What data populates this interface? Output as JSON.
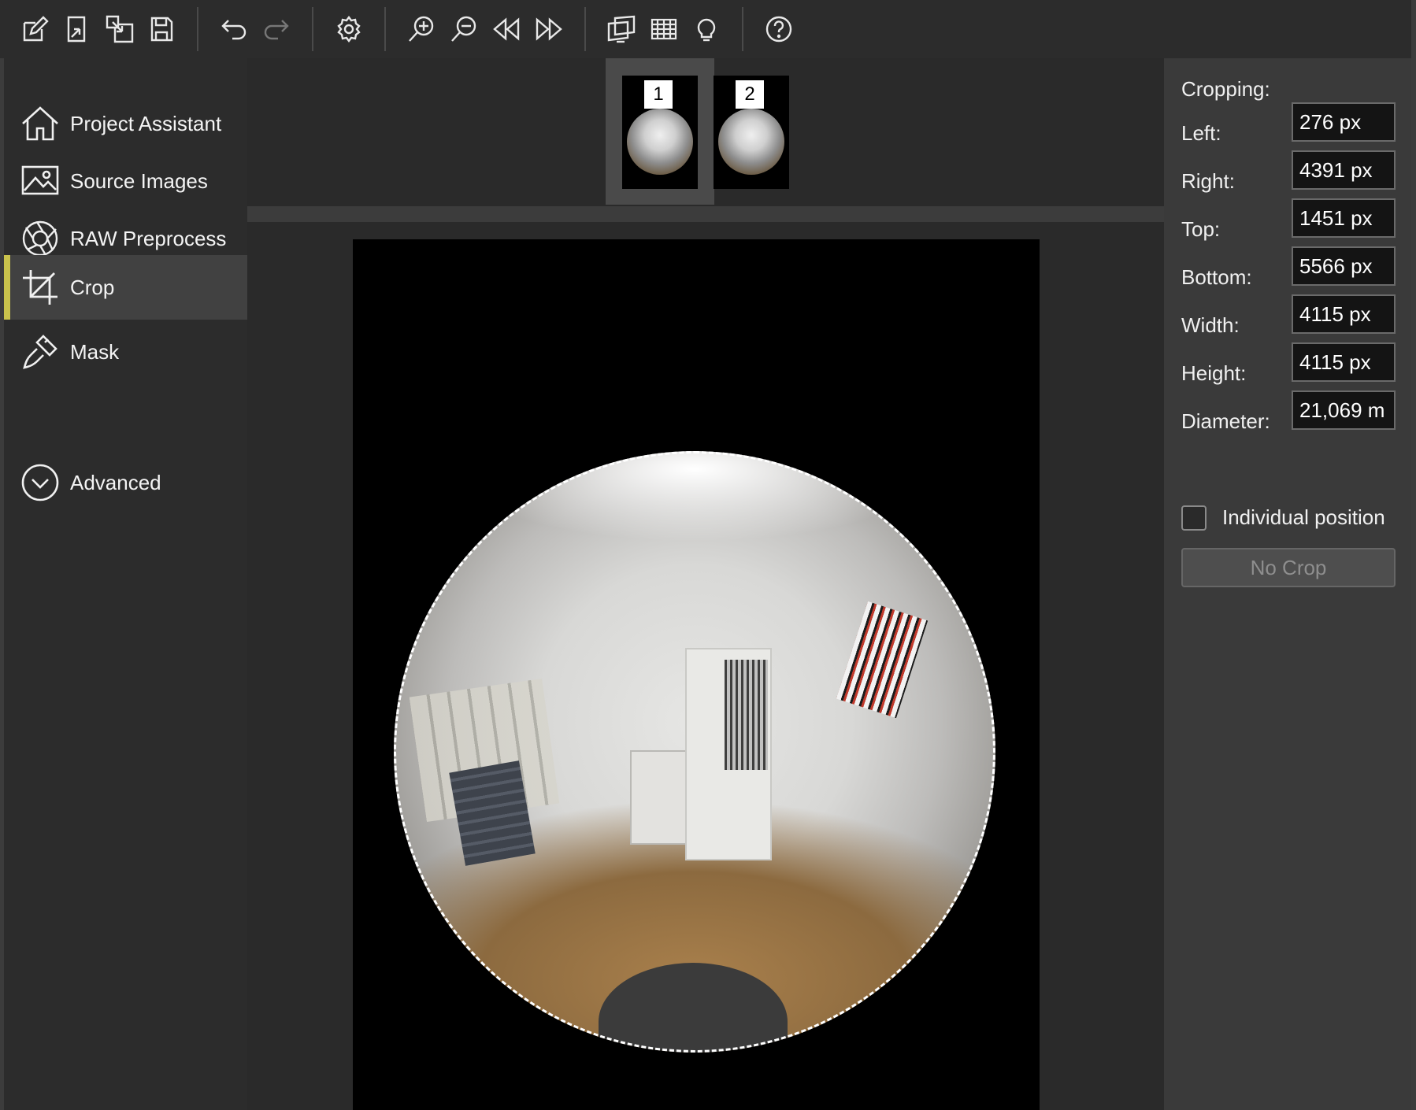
{
  "toolbar": {
    "buttons": [
      {
        "icon": "new-project-icon"
      },
      {
        "icon": "open-project-icon"
      },
      {
        "icon": "import-icon"
      },
      {
        "icon": "save-icon"
      },
      {
        "icon": "undo-icon"
      },
      {
        "icon": "redo-icon",
        "disabled": true
      },
      {
        "icon": "gear-icon"
      },
      {
        "icon": "zoom-in-icon"
      },
      {
        "icon": "zoom-out-icon"
      },
      {
        "icon": "previous-icon"
      },
      {
        "icon": "next-icon"
      },
      {
        "icon": "panorama-view-icon"
      },
      {
        "icon": "grid-icon"
      },
      {
        "icon": "lightbulb-icon"
      },
      {
        "icon": "help-icon"
      }
    ]
  },
  "sidebar": {
    "items": [
      {
        "label": "Project Assistant",
        "icon": "home-icon"
      },
      {
        "label": "Source Images",
        "icon": "image-icon"
      },
      {
        "label": "RAW Preprocess",
        "icon": "aperture-icon"
      },
      {
        "label": "Crop",
        "icon": "crop-icon",
        "active": true
      },
      {
        "label": "Mask",
        "icon": "brush-icon"
      },
      {
        "label": "Advanced",
        "icon": "chevron-down-circle-icon"
      }
    ],
    "active_color": "#c9c24c"
  },
  "thumbnails": [
    {
      "number": "1",
      "selected": true
    },
    {
      "number": "2",
      "selected": false
    }
  ],
  "cropping": {
    "title": "Cropping:",
    "fields": [
      {
        "label": "Left:",
        "value": "276 px"
      },
      {
        "label": "Right:",
        "value": "4391 px"
      },
      {
        "label": "Top:",
        "value": "1451 px"
      },
      {
        "label": "Bottom:",
        "value": "5566 px"
      },
      {
        "label": "Width:",
        "value": "4115 px"
      },
      {
        "label": "Height:",
        "value": "4115 px"
      },
      {
        "label": "Diameter:",
        "value": "21,069 m"
      }
    ],
    "individual_position_label": "Individual position",
    "individual_position_checked": false,
    "no_crop_label": "No Crop"
  }
}
